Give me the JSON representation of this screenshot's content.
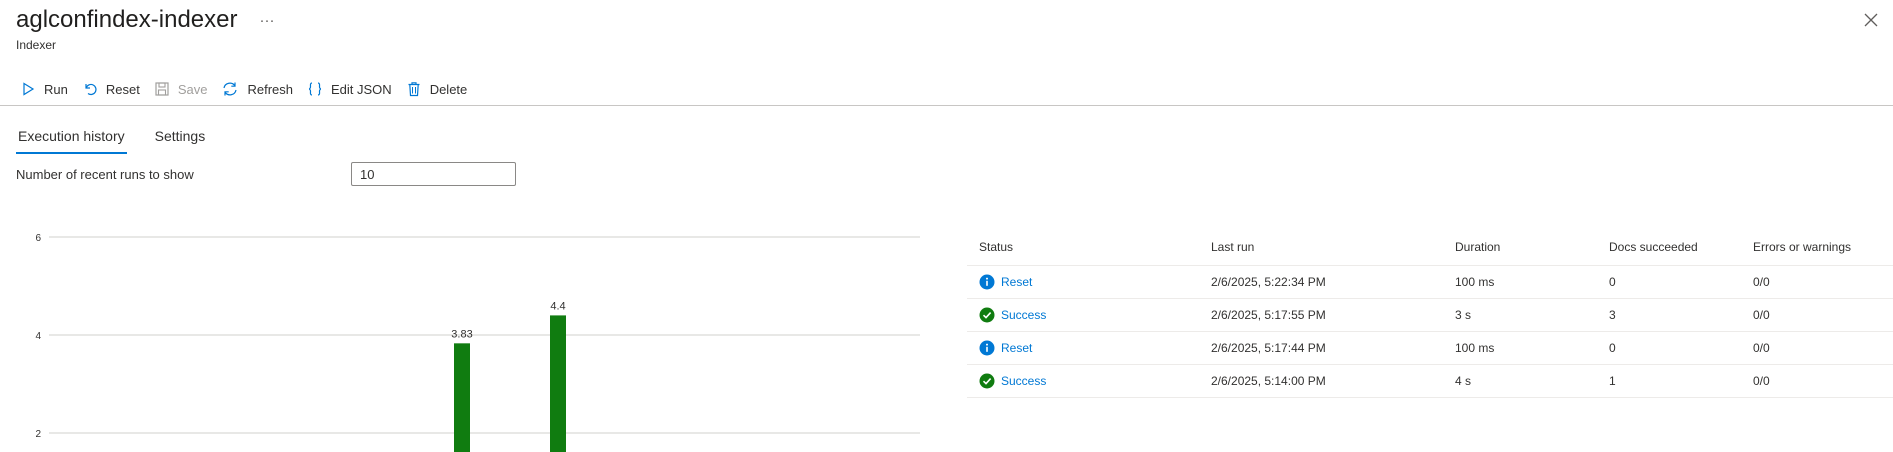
{
  "header": {
    "title": "aglconfindex-indexer",
    "subtitle": "Indexer",
    "more_label": "···"
  },
  "toolbar": {
    "run": "Run",
    "reset": "Reset",
    "save": "Save",
    "refresh": "Refresh",
    "edit_json": "Edit JSON",
    "delete": "Delete"
  },
  "tabs": {
    "execution_history": "Execution history",
    "settings": "Settings"
  },
  "runs": {
    "label": "Number of recent runs to show",
    "value": "10"
  },
  "chart_data": {
    "type": "bar",
    "y_ticks": [
      "6",
      "4",
      "2"
    ],
    "ylim_visible": [
      2,
      6
    ],
    "bars": [
      {
        "value": 3.83,
        "label": "3.83",
        "color": "#107c10"
      },
      {
        "value": 4.4,
        "label": "4.4",
        "color": "#107c10"
      }
    ]
  },
  "table": {
    "headers": [
      "Status",
      "Last run",
      "Duration",
      "Docs succeeded",
      "Errors or warnings"
    ],
    "rows": [
      {
        "status": "Reset",
        "icon": "info-icon",
        "last_run": "2/6/2025, 5:22:34 PM",
        "duration": "100 ms",
        "docs": "0",
        "errors": "0/0"
      },
      {
        "status": "Success",
        "icon": "success-icon",
        "last_run": "2/6/2025, 5:17:55 PM",
        "duration": "3 s",
        "docs": "3",
        "errors": "0/0"
      },
      {
        "status": "Reset",
        "icon": "info-icon",
        "last_run": "2/6/2025, 5:17:44 PM",
        "duration": "100 ms",
        "docs": "0",
        "errors": "0/0"
      },
      {
        "status": "Success",
        "icon": "success-icon",
        "last_run": "2/6/2025, 5:14:00 PM",
        "duration": "4 s",
        "docs": "1",
        "errors": "0/0"
      }
    ]
  },
  "colors": {
    "accent": "#0078d4",
    "success": "#107c10",
    "info": "#0078d4"
  }
}
